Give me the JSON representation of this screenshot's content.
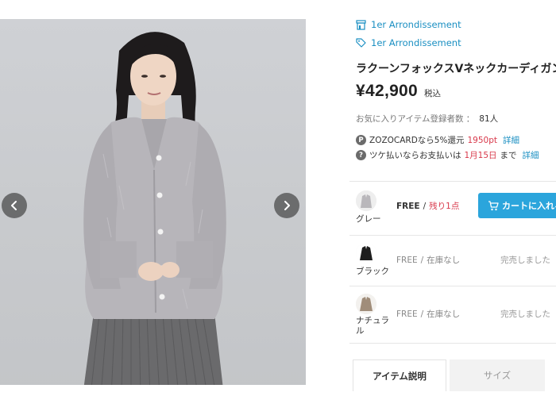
{
  "gallery": {
    "prev_label": "previous image",
    "next_label": "next image"
  },
  "shop": {
    "name": "1er Arrondissement",
    "icon": "shop-icon"
  },
  "brand": {
    "name": "1er Arrondissement",
    "icon": "tag-icon"
  },
  "product": {
    "title": "ラクーンフォックスVネックカーディガン",
    "price": "¥42,900",
    "tax_label": "税込"
  },
  "favorites": {
    "label": "お気に入りアイテム登録者数 ：",
    "count": "81人"
  },
  "zozocard": {
    "icon_letter": "P",
    "text_prefix": "ZOZOCARDなら5%還元",
    "points": "1950pt",
    "link": "詳細"
  },
  "tsuke": {
    "text_prefix": "ツケ払いならお支払いは",
    "date": "1月15日",
    "text_suffix": "まで",
    "link": "詳細"
  },
  "variants": [
    {
      "color": "グレー",
      "size": "FREE",
      "sep": "/",
      "stock": "残り1点",
      "action": "カートに入れる",
      "swatch_color": "#b9b7bb"
    },
    {
      "color": "ブラック",
      "size": "FREE",
      "sep": "/",
      "stock": "在庫なし",
      "status": "完売しました",
      "swatch_color": "#1e1e1e"
    },
    {
      "color": "ナチュラル",
      "size": "FREE",
      "sep": "/",
      "stock": "在庫なし",
      "status": "完売しました",
      "swatch_color": "#a08d7a"
    }
  ],
  "tabs": [
    {
      "label": "アイテム説明",
      "active": true
    },
    {
      "label": "サイズ",
      "active": false
    }
  ],
  "colors": {
    "link": "#1a8fc2",
    "accent_red": "#d8384a",
    "cart_button": "#2ba5dc"
  }
}
